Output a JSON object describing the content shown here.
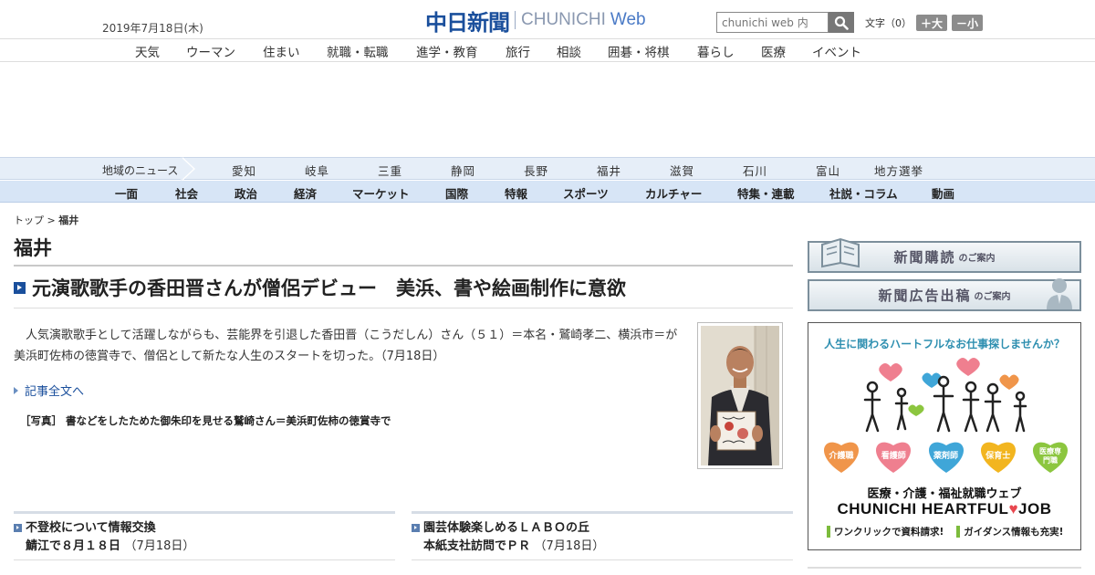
{
  "header": {
    "date": "2019年7月18日(木)",
    "logo_kanji": "中日新聞",
    "logo_en": "CHUNICHI",
    "logo_web": "Web",
    "search_placeholder": "chunichi web 内",
    "fontsize_label": "文字（0）",
    "fontsize_plus": "＋大",
    "fontsize_minus": "－小"
  },
  "topnav": [
    "天気",
    "ウーマン",
    "住まい",
    "就職・転職",
    "進学・教育",
    "旅行",
    "相談",
    "囲碁・将棋",
    "暮らし",
    "医療",
    "イベント"
  ],
  "regionnav": {
    "label": "地域のニュース",
    "items": [
      "愛知",
      "岐阜",
      "三重",
      "静岡",
      "長野",
      "福井",
      "滋賀",
      "石川",
      "富山",
      "地方選挙"
    ]
  },
  "catnav": [
    "一面",
    "社会",
    "政治",
    "経済",
    "マーケット",
    "国際",
    "特報",
    "スポーツ",
    "カルチャー",
    "特集・連載",
    "社説・コラム",
    "動画"
  ],
  "breadcrumb": {
    "top": "トップ",
    "sep": " > ",
    "current": "福井"
  },
  "page_title": "福井",
  "article": {
    "headline": "元演歌歌手の香田晋さんが僧侶デビュー　美浜、書や絵画制作に意欲",
    "lead": "人気演歌歌手として活躍しながらも、芸能界を引退した香田晋（こうだしん）さん（５１）＝本名・鷲崎孝二、横浜市＝が美浜町佐柿の徳賞寺で、僧侶として新たな人生のスタートを切った。（7月18日）",
    "more": "記事全文へ",
    "caption": "［写真］ 書などをしたためた御朱印を見せる鷲崎さん＝美浜町佐柿の徳賞寺で"
  },
  "subs": [
    {
      "line1": "不登校について情報交換",
      "line2": "鯖江で８月１８日",
      "date": "（7月18日）"
    },
    {
      "line1": "園芸体験楽しめるＬＡＢＯの丘",
      "line2": "本紙支社訪問でＰＲ",
      "date": "（7月18日）"
    }
  ],
  "sidebar": {
    "banner1": {
      "main": "新聞購読",
      "sub": "のご案内"
    },
    "banner2": {
      "main": "新聞広告出稿",
      "sub": "のご案内"
    },
    "heartful": {
      "top": "人生に関わるハートフルなお仕事探しませんか？",
      "bubbles": [
        {
          "label": "介護職",
          "color": "#f0954a"
        },
        {
          "label": "看護師",
          "color": "#ef7f8f"
        },
        {
          "label": "薬剤師",
          "color": "#3fa6d8"
        },
        {
          "label": "保育士",
          "color": "#f2b51f"
        },
        {
          "label": "医療専門職",
          "color": "#8cc63f"
        }
      ],
      "sub": "医療・介護・福祉就職ウェブ",
      "brand_a": "CHUNICHI HEARTFUL",
      "brand_heart": "♥",
      "brand_b": "JOB",
      "note1": "ワンクリックで資料請求!",
      "note2": "ガイダンス情報も充実!"
    }
  }
}
